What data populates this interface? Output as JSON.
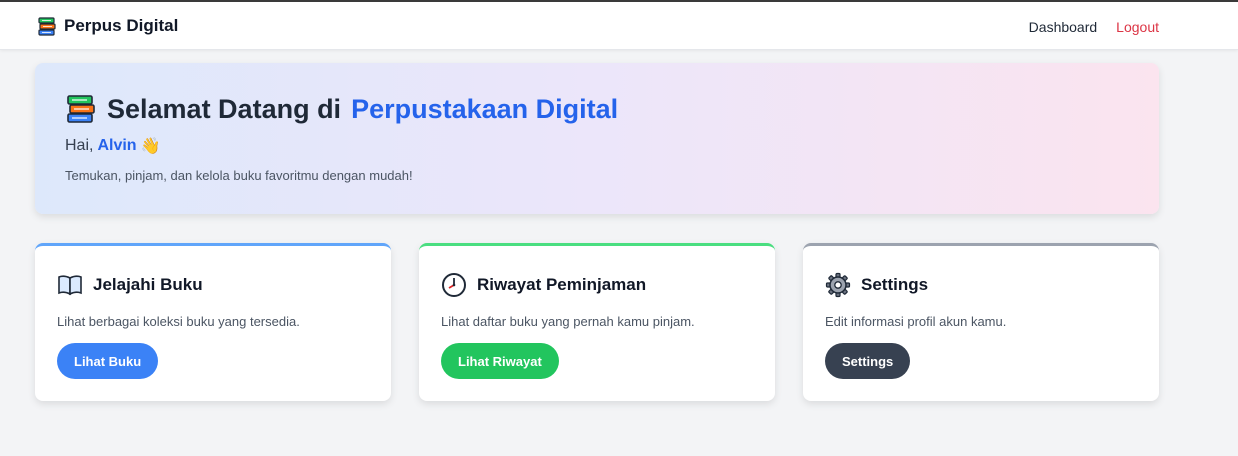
{
  "navbar": {
    "brand": "Perpus Digital",
    "links": [
      {
        "label": "Dashboard",
        "color": "#1f2937"
      },
      {
        "label": "Logout",
        "color": "#dc3545"
      }
    ]
  },
  "hero": {
    "title_prefix": "Selamat Datang di",
    "title_accent": "Perpustakaan Digital",
    "greeting_prefix": "Hai,",
    "user_name": "Alvin",
    "wave_emoji": "👋",
    "description": "Temukan, pinjam, dan kelola buku favoritmu dengan mudah!",
    "icon": "books-icon"
  },
  "cards": [
    {
      "icon": "open-book-icon",
      "title": "Jelajahi Buku",
      "description": "Lihat berbagai koleksi buku yang tersedia.",
      "button": "Lihat Buku",
      "accent": "#60a5fa",
      "button_color": "#3b82f6"
    },
    {
      "icon": "clock-icon",
      "title": "Riwayat Peminjaman",
      "description": "Lihat daftar buku yang pernah kamu pinjam.",
      "button": "Lihat Riwayat",
      "accent": "#4ade80",
      "button_color": "#22c55e"
    },
    {
      "icon": "gear-icon",
      "title": "Settings",
      "description": "Edit informasi profil akun kamu.",
      "button": "Settings",
      "accent": "#9ca3af",
      "button_color": "#374151"
    }
  ],
  "colors": {
    "accent_blue": "#2563eb",
    "background": "#f3f4f6"
  }
}
